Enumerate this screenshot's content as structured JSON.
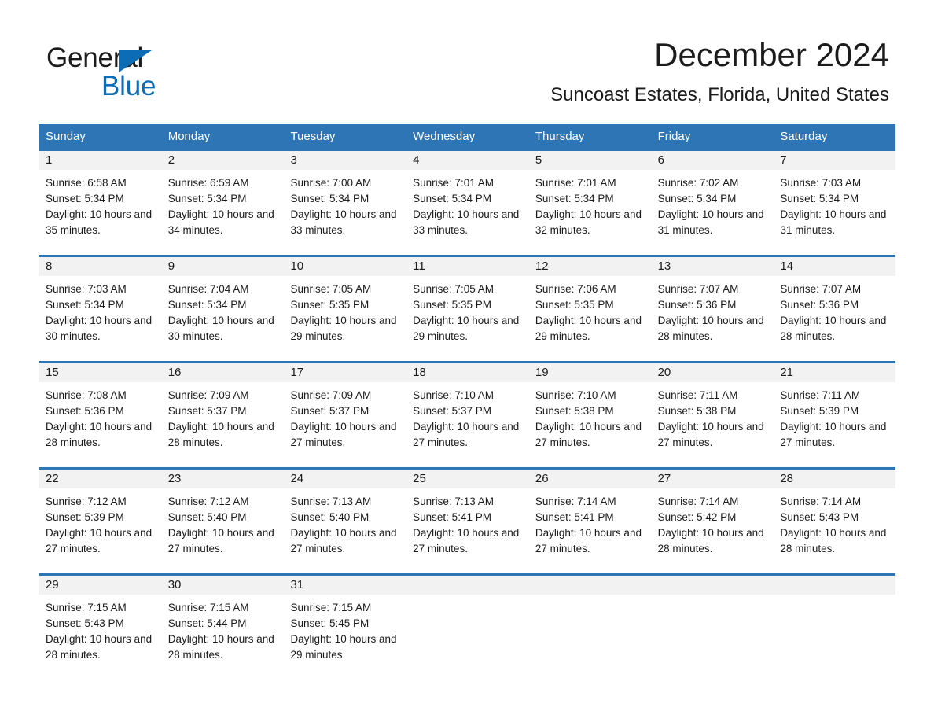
{
  "brand": {
    "name_part1": "General",
    "name_part2": "Blue",
    "accent_color": "#0d6cb6"
  },
  "header": {
    "title": "December 2024",
    "subtitle": "Suncoast Estates, Florida, United States",
    "header_bg_color": "#2e75b6",
    "day_strip_color": "#f2f2f2"
  },
  "weekdays": [
    {
      "label": "Sunday"
    },
    {
      "label": "Monday"
    },
    {
      "label": "Tuesday"
    },
    {
      "label": "Wednesday"
    },
    {
      "label": "Thursday"
    },
    {
      "label": "Friday"
    },
    {
      "label": "Saturday"
    }
  ],
  "weeks": [
    [
      {
        "day": "1",
        "sunrise": "Sunrise: 6:58 AM",
        "sunset": "Sunset: 5:34 PM",
        "daylight": "Daylight: 10 hours and 35 minutes."
      },
      {
        "day": "2",
        "sunrise": "Sunrise: 6:59 AM",
        "sunset": "Sunset: 5:34 PM",
        "daylight": "Daylight: 10 hours and 34 minutes."
      },
      {
        "day": "3",
        "sunrise": "Sunrise: 7:00 AM",
        "sunset": "Sunset: 5:34 PM",
        "daylight": "Daylight: 10 hours and 33 minutes."
      },
      {
        "day": "4",
        "sunrise": "Sunrise: 7:01 AM",
        "sunset": "Sunset: 5:34 PM",
        "daylight": "Daylight: 10 hours and 33 minutes."
      },
      {
        "day": "5",
        "sunrise": "Sunrise: 7:01 AM",
        "sunset": "Sunset: 5:34 PM",
        "daylight": "Daylight: 10 hours and 32 minutes."
      },
      {
        "day": "6",
        "sunrise": "Sunrise: 7:02 AM",
        "sunset": "Sunset: 5:34 PM",
        "daylight": "Daylight: 10 hours and 31 minutes."
      },
      {
        "day": "7",
        "sunrise": "Sunrise: 7:03 AM",
        "sunset": "Sunset: 5:34 PM",
        "daylight": "Daylight: 10 hours and 31 minutes."
      }
    ],
    [
      {
        "day": "8",
        "sunrise": "Sunrise: 7:03 AM",
        "sunset": "Sunset: 5:34 PM",
        "daylight": "Daylight: 10 hours and 30 minutes."
      },
      {
        "day": "9",
        "sunrise": "Sunrise: 7:04 AM",
        "sunset": "Sunset: 5:34 PM",
        "daylight": "Daylight: 10 hours and 30 minutes."
      },
      {
        "day": "10",
        "sunrise": "Sunrise: 7:05 AM",
        "sunset": "Sunset: 5:35 PM",
        "daylight": "Daylight: 10 hours and 29 minutes."
      },
      {
        "day": "11",
        "sunrise": "Sunrise: 7:05 AM",
        "sunset": "Sunset: 5:35 PM",
        "daylight": "Daylight: 10 hours and 29 minutes."
      },
      {
        "day": "12",
        "sunrise": "Sunrise: 7:06 AM",
        "sunset": "Sunset: 5:35 PM",
        "daylight": "Daylight: 10 hours and 29 minutes."
      },
      {
        "day": "13",
        "sunrise": "Sunrise: 7:07 AM",
        "sunset": "Sunset: 5:36 PM",
        "daylight": "Daylight: 10 hours and 28 minutes."
      },
      {
        "day": "14",
        "sunrise": "Sunrise: 7:07 AM",
        "sunset": "Sunset: 5:36 PM",
        "daylight": "Daylight: 10 hours and 28 minutes."
      }
    ],
    [
      {
        "day": "15",
        "sunrise": "Sunrise: 7:08 AM",
        "sunset": "Sunset: 5:36 PM",
        "daylight": "Daylight: 10 hours and 28 minutes."
      },
      {
        "day": "16",
        "sunrise": "Sunrise: 7:09 AM",
        "sunset": "Sunset: 5:37 PM",
        "daylight": "Daylight: 10 hours and 28 minutes."
      },
      {
        "day": "17",
        "sunrise": "Sunrise: 7:09 AM",
        "sunset": "Sunset: 5:37 PM",
        "daylight": "Daylight: 10 hours and 27 minutes."
      },
      {
        "day": "18",
        "sunrise": "Sunrise: 7:10 AM",
        "sunset": "Sunset: 5:37 PM",
        "daylight": "Daylight: 10 hours and 27 minutes."
      },
      {
        "day": "19",
        "sunrise": "Sunrise: 7:10 AM",
        "sunset": "Sunset: 5:38 PM",
        "daylight": "Daylight: 10 hours and 27 minutes."
      },
      {
        "day": "20",
        "sunrise": "Sunrise: 7:11 AM",
        "sunset": "Sunset: 5:38 PM",
        "daylight": "Daylight: 10 hours and 27 minutes."
      },
      {
        "day": "21",
        "sunrise": "Sunrise: 7:11 AM",
        "sunset": "Sunset: 5:39 PM",
        "daylight": "Daylight: 10 hours and 27 minutes."
      }
    ],
    [
      {
        "day": "22",
        "sunrise": "Sunrise: 7:12 AM",
        "sunset": "Sunset: 5:39 PM",
        "daylight": "Daylight: 10 hours and 27 minutes."
      },
      {
        "day": "23",
        "sunrise": "Sunrise: 7:12 AM",
        "sunset": "Sunset: 5:40 PM",
        "daylight": "Daylight: 10 hours and 27 minutes."
      },
      {
        "day": "24",
        "sunrise": "Sunrise: 7:13 AM",
        "sunset": "Sunset: 5:40 PM",
        "daylight": "Daylight: 10 hours and 27 minutes."
      },
      {
        "day": "25",
        "sunrise": "Sunrise: 7:13 AM",
        "sunset": "Sunset: 5:41 PM",
        "daylight": "Daylight: 10 hours and 27 minutes."
      },
      {
        "day": "26",
        "sunrise": "Sunrise: 7:14 AM",
        "sunset": "Sunset: 5:41 PM",
        "daylight": "Daylight: 10 hours and 27 minutes."
      },
      {
        "day": "27",
        "sunrise": "Sunrise: 7:14 AM",
        "sunset": "Sunset: 5:42 PM",
        "daylight": "Daylight: 10 hours and 28 minutes."
      },
      {
        "day": "28",
        "sunrise": "Sunrise: 7:14 AM",
        "sunset": "Sunset: 5:43 PM",
        "daylight": "Daylight: 10 hours and 28 minutes."
      }
    ],
    [
      {
        "day": "29",
        "sunrise": "Sunrise: 7:15 AM",
        "sunset": "Sunset: 5:43 PM",
        "daylight": "Daylight: 10 hours and 28 minutes."
      },
      {
        "day": "30",
        "sunrise": "Sunrise: 7:15 AM",
        "sunset": "Sunset: 5:44 PM",
        "daylight": "Daylight: 10 hours and 28 minutes."
      },
      {
        "day": "31",
        "sunrise": "Sunrise: 7:15 AM",
        "sunset": "Sunset: 5:45 PM",
        "daylight": "Daylight: 10 hours and 29 minutes."
      },
      {
        "day": "",
        "sunrise": "",
        "sunset": "",
        "daylight": ""
      },
      {
        "day": "",
        "sunrise": "",
        "sunset": "",
        "daylight": ""
      },
      {
        "day": "",
        "sunrise": "",
        "sunset": "",
        "daylight": ""
      },
      {
        "day": "",
        "sunrise": "",
        "sunset": "",
        "daylight": ""
      }
    ]
  ]
}
